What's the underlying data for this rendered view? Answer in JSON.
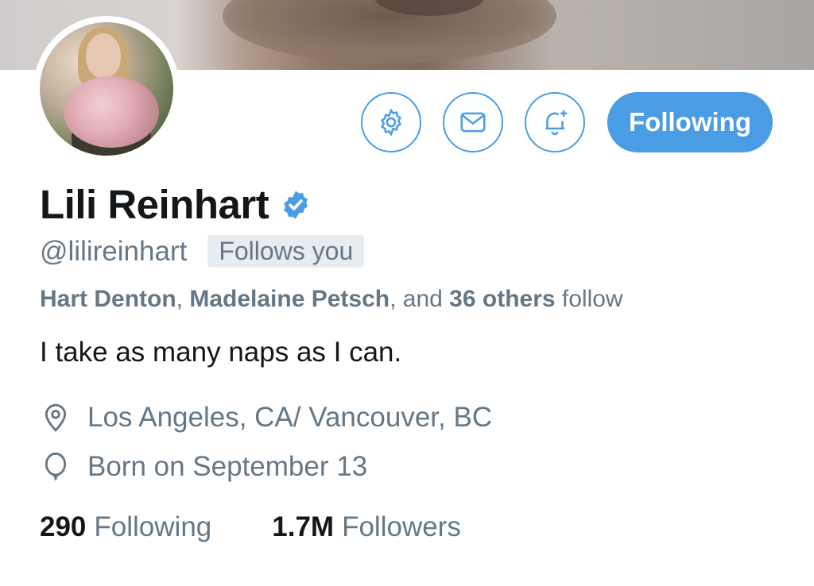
{
  "profile": {
    "name": "Lili Reinhart",
    "handle": "@lilireinhart",
    "follows_you": "Follows you",
    "followed_by": {
      "names": [
        "Hart Denton",
        "Madelaine Petsch"
      ],
      "separator": ", ",
      "and": ", and ",
      "others": "36 others",
      "suffix": " follow"
    },
    "bio": "I take as many naps as I can.",
    "location": "Los Angeles, CA/ Vancouver, BC",
    "birthday": "Born on September 13",
    "stats": {
      "following_count": "290",
      "following_label": "Following",
      "followers_count": "1.7M",
      "followers_label": "Followers"
    }
  },
  "actions": {
    "follow_button": "Following",
    "icons": [
      "gear-icon",
      "mail-icon",
      "bell-plus-icon"
    ]
  },
  "icons": {
    "verified": "verified-badge-icon",
    "location": "location-pin-icon",
    "birthday": "balloon-icon"
  },
  "colors": {
    "accent": "#4a9de5",
    "secondary_text": "#657786",
    "primary_text": "#14171a",
    "badge_bg": "#e6ecf0"
  }
}
